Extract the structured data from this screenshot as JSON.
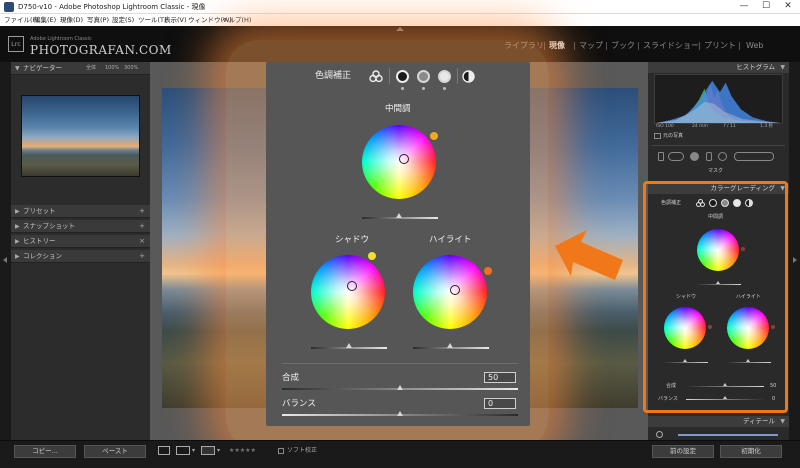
{
  "window": {
    "title": "D750-v10 - Adobe Photoshop Lightroom Classic - 現像",
    "minimize": "—",
    "maximize": "☐",
    "close": "✕"
  },
  "menu": [
    "ファイル(F)",
    "編集(E)",
    "現像(D)",
    "写真(P)",
    "設定(S)",
    "ツール(T)",
    "表示(V)",
    "ウィンドウ(W)",
    "ヘルプ(H)"
  ],
  "header": {
    "badge": "Lrc",
    "brand_top": "Adobe Lightroom Classic",
    "brand": "PHOTOGRAFAN.COM",
    "modules": [
      "ライブラリ",
      "現像",
      "マップ",
      "ブック",
      "スライドショー",
      "プリント",
      "Web"
    ],
    "active_module": "現像"
  },
  "left_panel": {
    "navigator": {
      "label": "ナビゲーター",
      "zoom": [
        "全体",
        "100%",
        "300%"
      ]
    },
    "sections": [
      {
        "label": "プリセット",
        "icon": "+"
      },
      {
        "label": "スナップショット",
        "icon": "+"
      },
      {
        "label": "ヒストリー",
        "icon": "×"
      },
      {
        "label": "コレクション",
        "icon": "+"
      }
    ]
  },
  "color_grading_popup": {
    "title": "色調補正",
    "midtones_label": "中間調",
    "shadows_label": "シャドウ",
    "highlights_label": "ハイライト",
    "blending_label": "合成",
    "blending_value": "50",
    "balance_label": "バランス",
    "balance_value": "0",
    "colors": {
      "midtone_dot": "#f5a623",
      "shadow_dot": "#f0e030",
      "highlight_dot": "#f07020",
      "accent": "#f07818"
    }
  },
  "right_panel": {
    "histogram_label": "ヒストグラム",
    "histogram_info": [
      "ISO 100",
      "24 mm",
      "f / 11",
      "1.3 秒"
    ],
    "original_photo_label": "元の写真",
    "mask_label": "マスク",
    "color_grading_label": "カラーグレーディング",
    "mini_title": "色調補正",
    "mini_midtones": "中間調",
    "mini_shadows": "シャドウ",
    "mini_highlights": "ハイライト",
    "mini_blending": "合成",
    "mini_blending_value": "50",
    "mini_balance": "バランス",
    "mini_balance_value": "0",
    "detail_label": "ディテール"
  },
  "bottom": {
    "copy": "コピー...",
    "paste": "ペースト",
    "soft_proof": "ソフト校正",
    "rating": "★★★★★",
    "prev_settings": "前の設定",
    "reset": "初期化"
  }
}
